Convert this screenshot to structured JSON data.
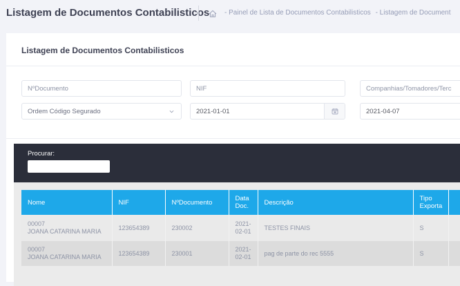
{
  "header": {
    "title": "Listagem de Documentos Contabilisticos",
    "breadcrumb": [
      "- Painel de Lista de Documentos Contabilisticos",
      "- Listagem de Document"
    ]
  },
  "card": {
    "title": "Listagem de Documentos Contabilisticos"
  },
  "filters": {
    "ndocumento_placeholder": "NºDocumento",
    "nif_placeholder": "NIF",
    "companhias_placeholder": "Companhias/Tomadores/Terc",
    "ordem_select": "Ordem Código Segurado",
    "date_from": "2021-01-01",
    "date_to": "2021-04-07"
  },
  "search": {
    "label": "Procurar:",
    "value": ""
  },
  "table": {
    "headers": [
      "Nome",
      "NIF",
      "NºDocumento",
      "Data Doc.",
      "Descrição",
      "Tipo Exporta"
    ],
    "rows": [
      {
        "code": "00007",
        "name": "JOANA CATARINA MARIA",
        "nif": "123654389",
        "ndoc": "230002",
        "date": "2021-02-01",
        "desc": "TESTES FINAIS",
        "tipo": "S"
      },
      {
        "code": "00007",
        "name": "JOANA CATARINA MARIA",
        "nif": "123654389",
        "ndoc": "230001",
        "date": "2021-02-01",
        "desc": "pag de parte do rec 5555",
        "tipo": "S"
      }
    ]
  },
  "colors": {
    "header_blue": "#1ea8e9",
    "dark_bar": "#2b2e3a",
    "page_bg": "#f2f3f8"
  },
  "icons": [
    "home-icon",
    "chevron-down-icon",
    "calendar-icon"
  ]
}
